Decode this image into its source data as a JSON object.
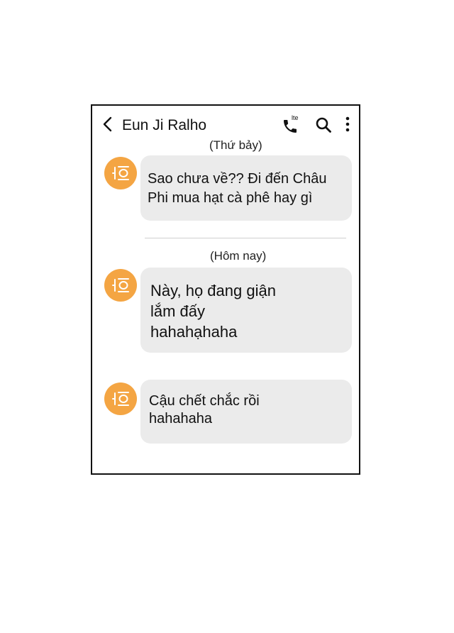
{
  "header": {
    "contact_name": "Eun Ji Ralho",
    "call_badge": "lte",
    "back_icon": "chevron-left-icon",
    "call_icon": "phone-icon",
    "search_icon": "search-icon",
    "more_icon": "more-vertical-icon"
  },
  "conversation": {
    "groups": [
      {
        "date_label": "(Thứ bảy)",
        "messages": [
          {
            "text": "Sao chưa về?? Đi đến Châu\nPhi mua hạt cà phê hay gì"
          }
        ]
      },
      {
        "date_label": "(Hôm nay)",
        "messages": [
          {
            "text": "Này, họ đang giận\nlắm đấy\nhahahạhaha"
          },
          {
            "text": "Cậu chết chắc rồi\nhahahaha"
          }
        ]
      }
    ]
  },
  "colors": {
    "avatar": "#f4a543",
    "bubble": "#ebebeb",
    "frame": "#111111"
  }
}
